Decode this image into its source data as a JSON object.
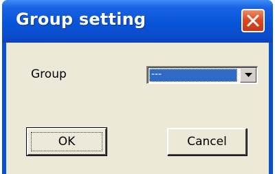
{
  "window": {
    "title": "Group setting",
    "close_icon": "close-icon"
  },
  "form": {
    "group_label": "Group",
    "group_value": "---",
    "dropdown_icon": "chevron-down-icon"
  },
  "buttons": {
    "ok_label": "OK",
    "cancel_label": "Cancel"
  },
  "colors": {
    "titlebar": "#0a4fd6",
    "dialog_bg": "#ece9d8",
    "selection": "#316ac5",
    "close_button": "#dd4a22"
  }
}
